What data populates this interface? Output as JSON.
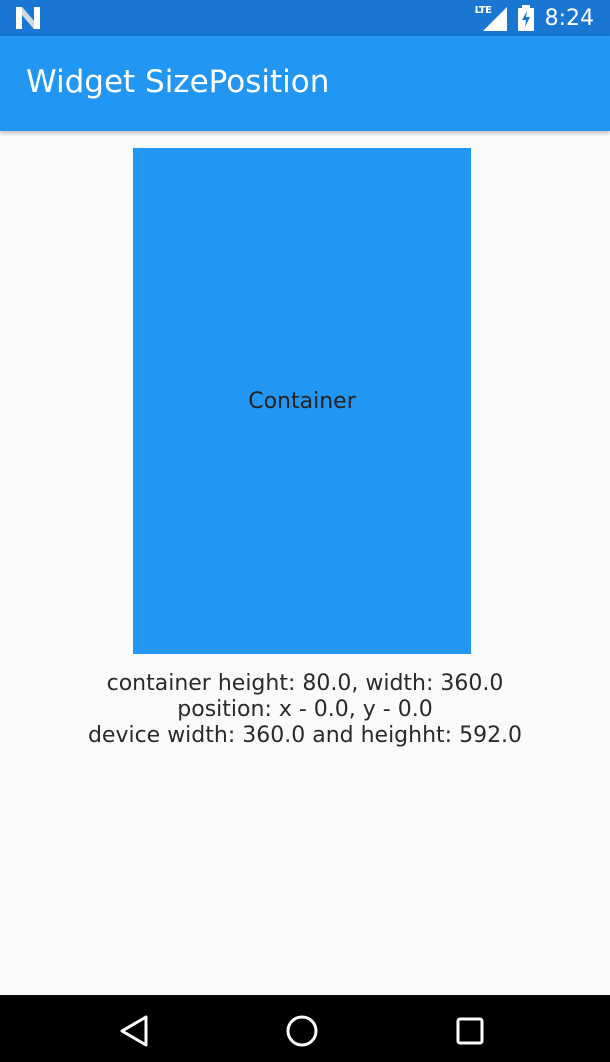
{
  "status_bar": {
    "carrier_icon": "n-logo-icon",
    "network_label": "LTE",
    "signal_icon": "signal-icon",
    "battery_icon": "battery-charging-icon",
    "time": "8:24"
  },
  "app_bar": {
    "title": "Widget SizePosition"
  },
  "main": {
    "container_label": "Container",
    "info_lines": [
      "container height: 80.0, width: 360.0",
      "position: x - 0.0, y - 0.0",
      "device width: 360.0 and heighht: 592.0"
    ]
  },
  "nav_bar": {
    "back_icon": "back-icon",
    "home_icon": "home-icon",
    "recents_icon": "recents-icon"
  },
  "colors": {
    "status_bar": "#1976d2",
    "app_bar": "#2196f3",
    "container": "#2196f3",
    "background": "#fafafa",
    "nav_bar": "#000000"
  }
}
